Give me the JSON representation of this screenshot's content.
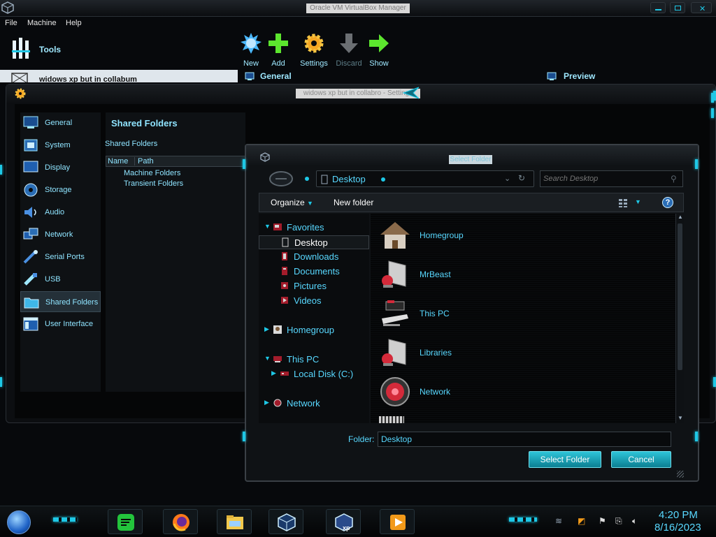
{
  "manager": {
    "title": "Oracle VM VirtualBox Manager",
    "menu": [
      "File",
      "Machine",
      "Help"
    ],
    "tools_label": "Tools",
    "toolbar": [
      {
        "label": "New",
        "icon": "new-icon",
        "enabled": true
      },
      {
        "label": "Add",
        "icon": "add-icon",
        "enabled": true
      },
      {
        "label": "Settings",
        "icon": "settings-icon",
        "enabled": true
      },
      {
        "label": "Discard",
        "icon": "discard-icon",
        "enabled": false
      },
      {
        "label": "Show",
        "icon": "show-icon",
        "enabled": true
      }
    ],
    "vm_name": "widows xp but in collabum",
    "general_label": "General",
    "preview_label": "Preview"
  },
  "settings": {
    "title": "widows xp but in collabro - Settings",
    "nav": [
      {
        "label": "General",
        "icon": "general-icon"
      },
      {
        "label": "System",
        "icon": "system-icon"
      },
      {
        "label": "Display",
        "icon": "display-icon"
      },
      {
        "label": "Storage",
        "icon": "storage-icon"
      },
      {
        "label": "Audio",
        "icon": "audio-icon"
      },
      {
        "label": "Network",
        "icon": "network-icon"
      },
      {
        "label": "Serial Ports",
        "icon": "serial-ports-icon"
      },
      {
        "label": "USB",
        "icon": "usb-icon"
      },
      {
        "label": "Shared Folders",
        "icon": "shared-folders-icon",
        "selected": true
      },
      {
        "label": "User Interface",
        "icon": "user-interface-icon"
      }
    ],
    "section_title": "Shared Folders",
    "subheading": "Shared Folders",
    "columns": [
      "Name",
      "Path"
    ],
    "rows": [
      "Machine Folders",
      "Transient Folders"
    ]
  },
  "dialog": {
    "title": "Select Folder",
    "address": "Desktop",
    "search_placeholder": "Search Desktop",
    "organize_label": "Organize",
    "new_folder_label": "New folder",
    "tree": [
      {
        "label": "Favorites",
        "level": 0,
        "expanded": true
      },
      {
        "label": "Desktop",
        "level": 1,
        "selected": true
      },
      {
        "label": "Downloads",
        "level": 1
      },
      {
        "label": "Documents",
        "level": 1
      },
      {
        "label": "Pictures",
        "level": 1
      },
      {
        "label": "Videos",
        "level": 1
      },
      {
        "label": "Homegroup",
        "level": 0,
        "expanded": false
      },
      {
        "label": "This PC",
        "level": 0,
        "expanded": true
      },
      {
        "label": "Local Disk (C:)",
        "level": 1
      },
      {
        "label": "Network",
        "level": 0,
        "expanded": false
      }
    ],
    "items": [
      {
        "label": "Homegroup",
        "icon": "homegroup-icon"
      },
      {
        "label": "MrBeast",
        "icon": "user-folder-icon"
      },
      {
        "label": "This PC",
        "icon": "this-pc-icon"
      },
      {
        "label": "Libraries",
        "icon": "libraries-icon"
      },
      {
        "label": "Network",
        "icon": "network-icon"
      }
    ],
    "folder_label": "Folder:",
    "folder_value": "Desktop",
    "select_button": "Select Folder",
    "cancel_button": "Cancel"
  },
  "taskbar": {
    "apps": [
      {
        "name": "spotify",
        "icon": "spotify-icon"
      },
      {
        "name": "firefox",
        "icon": "firefox-icon"
      },
      {
        "name": "file-explorer",
        "icon": "file-explorer-icon"
      },
      {
        "name": "virtualbox",
        "icon": "virtualbox-icon"
      },
      {
        "name": "virtualbox-xp",
        "icon": "virtualbox-xp-icon"
      },
      {
        "name": "media-player",
        "icon": "media-player-icon"
      }
    ],
    "time": "4:20 PM",
    "date": "8/16/2023"
  },
  "colors": {
    "accent": "#1ec8e6",
    "text_cyan": "#58d8ff",
    "background": "#050608"
  }
}
